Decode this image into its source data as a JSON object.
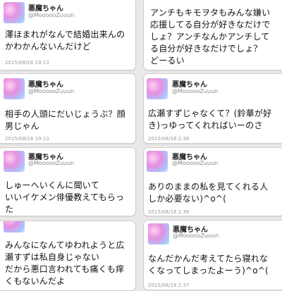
{
  "tweets": [
    {
      "name": "悪魔ちゃん",
      "handle": "@MoooooZuuun",
      "text": "澤ほまれがなんで結婚出来んの\nかわかんないんだけど",
      "time": "2015/08/16 19:13"
    },
    {
      "text": "アンチもキモヲタもみんな嫌い\n応援してる自分が好きなだけで\nしょ？アンチなんかアンチして\nる自分が好きなだけでしょ？\nどーるい"
    },
    {
      "name": "悪魔ちゃん",
      "handle": "@MoooooZuuun",
      "text": "相手の人頭にだいじょうぶ？顔\n男じゃん",
      "time": "2015/08/16 19:13"
    },
    {
      "name": "悪魔ちゃん",
      "handle": "@MoooooZuuun",
      "text": "広瀬すずじゃなくて？(鈴華が好\nき)っゆってくれればいーのさ",
      "time": "2015/08/18 2:36"
    },
    {
      "name": "悪魔ちゃん",
      "handle": "@MoooooZuuun",
      "text": "しゅーへいくんに聞いて\nいいイケメン俳優教えてもらっ\nた"
    },
    {
      "name": "悪魔ちゃん",
      "handle": "@MoooooZuuun",
      "text": "ありのままの私を見てくれる人\nしか必要ない)^o^(",
      "time": "2015/08/18 2:36"
    },
    {
      "text": "みんなになんてゆわれようと広\n瀬すずは私自身じゃない\nだから悪口言われても痛くも痒\nくもないんだよ"
    },
    {
      "name": "悪魔ちゃん",
      "handle": "@MoooooZuuun",
      "text": "なんだかんだ考えてたら寝れな\nくなってしまったよーう)^o^(",
      "time": "2015/08/18 2:37"
    }
  ]
}
